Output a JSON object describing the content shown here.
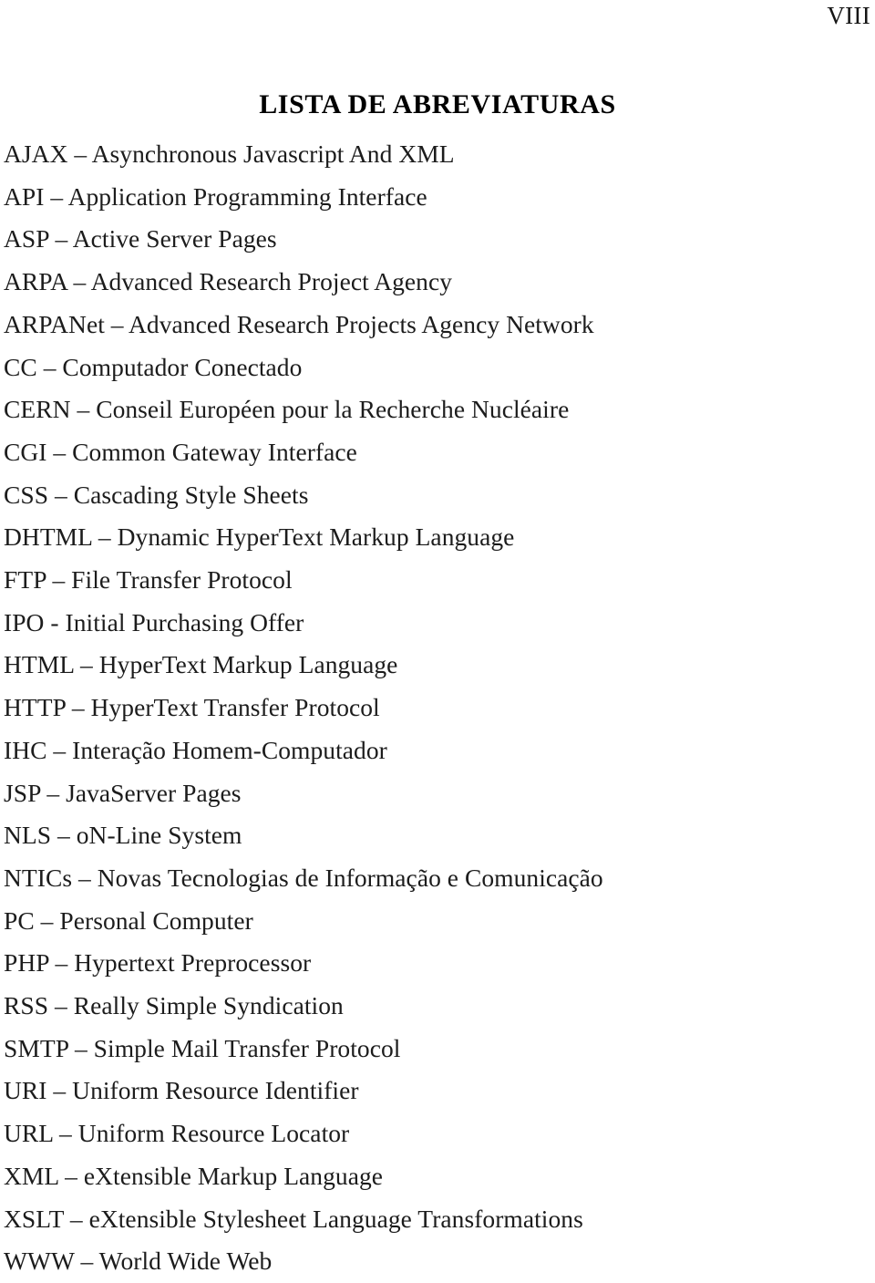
{
  "document": {
    "page_number": "VIII",
    "title": "LISTA DE ABREVIATURAS",
    "language": "pt-BR",
    "colors": {
      "background": "#ffffff",
      "text": "#1c1c1c",
      "title": "#000000"
    }
  },
  "abbreviations": [
    {
      "term": "AJAX",
      "separator": "–",
      "definition": "Asynchronous Javascript And XML",
      "line": "AJAX – Asynchronous Javascript And XML"
    },
    {
      "term": "API",
      "separator": "–",
      "definition": "Application Programming Interface",
      "line": "API – Application Programming Interface"
    },
    {
      "term": "ASP",
      "separator": "–",
      "definition": "Active Server Pages",
      "line": "ASP – Active Server Pages"
    },
    {
      "term": "ARPA",
      "separator": "–",
      "definition": "Advanced Research Project Agency",
      "line": "ARPA – Advanced Research Project Agency"
    },
    {
      "term": "ARPANet",
      "separator": "–",
      "definition": "Advanced Research Projects Agency Network",
      "line": "ARPANet – Advanced Research Projects Agency Network"
    },
    {
      "term": "CC",
      "separator": "–",
      "definition": "Computador Conectado",
      "line": "CC – Computador Conectado"
    },
    {
      "term": "CERN",
      "separator": "–",
      "definition": "Conseil Européen pour la Recherche Nucléaire",
      "line": "CERN – Conseil Européen pour la Recherche Nucléaire"
    },
    {
      "term": "CGI",
      "separator": "–",
      "definition": "Common Gateway Interface",
      "line": "CGI – Common Gateway Interface"
    },
    {
      "term": "CSS",
      "separator": "–",
      "definition": "Cascading Style Sheets",
      "line": "CSS – Cascading Style Sheets"
    },
    {
      "term": "DHTML",
      "separator": "–",
      "definition": "Dynamic HyperText Markup Language",
      "line": "DHTML – Dynamic HyperText Markup Language"
    },
    {
      "term": "FTP",
      "separator": "–",
      "definition": "File Transfer Protocol",
      "line": "FTP – File Transfer Protocol"
    },
    {
      "term": "IPO",
      "separator": "-",
      "definition": "Initial Purchasing Offer",
      "line": "IPO - Initial Purchasing Offer"
    },
    {
      "term": "HTML",
      "separator": "–",
      "definition": "HyperText Markup Language",
      "line": "HTML – HyperText Markup Language"
    },
    {
      "term": "HTTP",
      "separator": "–",
      "definition": "HyperText Transfer Protocol",
      "line": "HTTP – HyperText Transfer Protocol"
    },
    {
      "term": "IHC",
      "separator": "–",
      "definition": "Interação Homem-Computador",
      "line": "IHC – Interação Homem-Computador"
    },
    {
      "term": "JSP",
      "separator": "–",
      "definition": "JavaServer Pages",
      "line": "JSP – JavaServer Pages"
    },
    {
      "term": "NLS",
      "separator": "–",
      "definition": "oN-Line System",
      "line": "NLS – oN-Line System"
    },
    {
      "term": "NTICs",
      "separator": "–",
      "definition": "Novas Tecnologias de Informação e Comunicação",
      "line": "NTICs – Novas Tecnologias de Informação e Comunicação"
    },
    {
      "term": "PC",
      "separator": "–",
      "definition": "Personal Computer",
      "line": "PC – Personal Computer"
    },
    {
      "term": "PHP",
      "separator": "–",
      "definition": "Hypertext Preprocessor",
      "line": "PHP – Hypertext Preprocessor"
    },
    {
      "term": "RSS",
      "separator": "–",
      "definition": "Really Simple Syndication",
      "line": "RSS – Really Simple Syndication"
    },
    {
      "term": "SMTP",
      "separator": "–",
      "definition": "Simple Mail Transfer Protocol",
      "line": "SMTP – Simple Mail Transfer Protocol"
    },
    {
      "term": "URI",
      "separator": "–",
      "definition": "Uniform Resource Identifier",
      "line": "URI – Uniform Resource Identifier"
    },
    {
      "term": "URL",
      "separator": "–",
      "definition": "Uniform Resource Locator",
      "line": "URL – Uniform Resource Locator"
    },
    {
      "term": "XML",
      "separator": "–",
      "definition": "eXtensible Markup Language",
      "line": "XML – eXtensible Markup Language"
    },
    {
      "term": "XSLT",
      "separator": "–",
      "definition": "eXtensible Stylesheet Language Transformations",
      "line": "XSLT – eXtensible Stylesheet Language Transformations"
    },
    {
      "term": "WWW",
      "separator": "–",
      "definition": "World Wide Web",
      "line": "WWW – World Wide Web"
    }
  ]
}
